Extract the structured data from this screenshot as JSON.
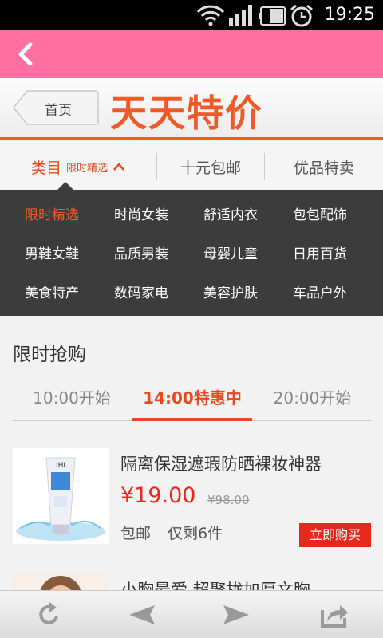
{
  "status_bar": {
    "time": "19:25",
    "icons": [
      "wifi-icon",
      "signal-icon",
      "battery-icon",
      "alarm-icon"
    ]
  },
  "app_bar": {
    "back_icon": "chevron-left-icon",
    "color": "#ff6fa0"
  },
  "header": {
    "home_label": "首页",
    "title": "天天特价",
    "accent": "#f0592a"
  },
  "tabs": {
    "category": "类目",
    "category_sub": "限时精选",
    "free_shipping": "十元包邮",
    "quality": "优品特卖"
  },
  "categories": [
    {
      "label": "限时精选",
      "active": true
    },
    {
      "label": "时尚女装",
      "active": false
    },
    {
      "label": "舒适内衣",
      "active": false
    },
    {
      "label": "包包配饰",
      "active": false
    },
    {
      "label": "男鞋女鞋",
      "active": false
    },
    {
      "label": "品质男装",
      "active": false
    },
    {
      "label": "母婴儿童",
      "active": false
    },
    {
      "label": "日用百货",
      "active": false
    },
    {
      "label": "美食特产",
      "active": false
    },
    {
      "label": "数码家电",
      "active": false
    },
    {
      "label": "美容护肤",
      "active": false
    },
    {
      "label": "车品户外",
      "active": false
    }
  ],
  "flash_sale": {
    "title": "限时抢购",
    "time_tabs": [
      "10:00开始",
      "14:00特惠中",
      "20:00开始"
    ],
    "active_tab": 1
  },
  "products": [
    {
      "name": "隔离保湿遮瑕防晒裸妆神器",
      "price": "¥19.00",
      "original_price": "¥98.00",
      "shipping": "包邮",
      "stock": "仅剩6件",
      "buy_label": "立即购买"
    },
    {
      "name": "小胸最爱 超聚拢加厚文胸"
    }
  ],
  "toolbar": {
    "icons": [
      "refresh-icon",
      "back-arrow-icon",
      "forward-arrow-icon",
      "share-icon"
    ]
  }
}
